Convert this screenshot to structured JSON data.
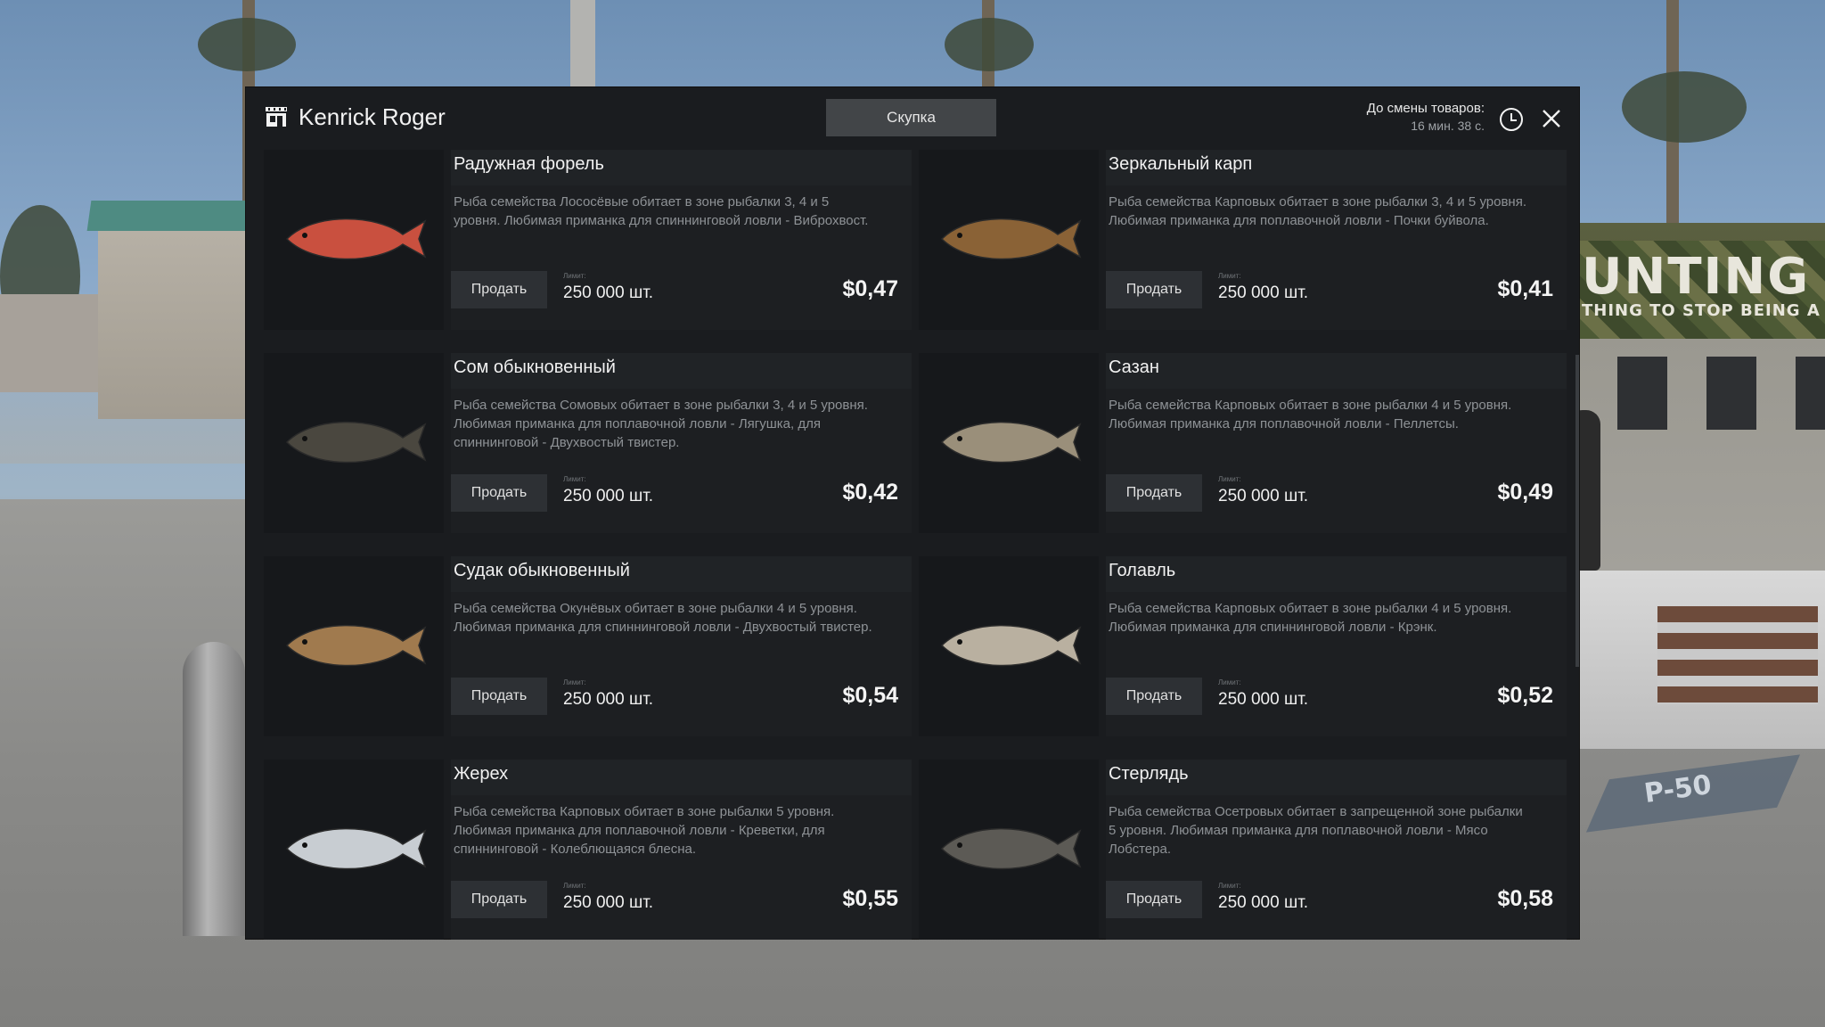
{
  "window": {
    "title": "Kenrick Roger",
    "tab_label": "Скупка",
    "timer_label": "До смены товаров:",
    "timer_value": "16 мин. 38 с."
  },
  "background": {
    "sign_text": "UNTING S",
    "sign_sub": "THING TO STOP BEING A",
    "mat_text": "P-50"
  },
  "common": {
    "sell_label": "Продать",
    "limit_label": "Лимит:"
  },
  "items": [
    {
      "name": "Радужная форель",
      "desc": "Рыба семейства Лососёвые обитает в зоне рыбалки 3, 4 и 5 уровня. Любимая приманка для спиннинговой ловли - Виброхвост.",
      "limit": "250 000 шт.",
      "price": "$0,47",
      "icon": "rainbow-trout-icon",
      "color": "#c9503f"
    },
    {
      "name": "Зеркальный карп",
      "desc": "Рыба семейства Карповых обитает в зоне рыбалки 3, 4 и 5 уровня. Любимая приманка для поплавочной ловли - Почки буйвола.",
      "limit": "250 000 шт.",
      "price": "$0,41",
      "icon": "mirror-carp-icon",
      "color": "#8a6236"
    },
    {
      "name": "Сом обыкновенный",
      "desc": "Рыба семейства Сомовых обитает в зоне рыбалки 3, 4 и 5 уровня. Любимая приманка для поплавочной ловли - Лягушка, для спиннинговой - Двухвостый твистер.",
      "limit": "250 000 шт.",
      "price": "$0,42",
      "icon": "catfish-icon",
      "color": "#4a473f"
    },
    {
      "name": "Сазан",
      "desc": "Рыба семейства Карповых обитает в зоне рыбалки 4 и 5 уровня. Любимая приманка для поплавочной ловли - Пеллетсы.",
      "limit": "250 000 шт.",
      "price": "$0,49",
      "icon": "wild-carp-icon",
      "color": "#9a8f7a"
    },
    {
      "name": "Судак обыкновенный",
      "desc": "Рыба семейства Окунёвых обитает в зоне рыбалки 4 и 5 уровня. Любимая приманка для спиннинговой ловли - Двухвостый твистер.",
      "limit": "250 000 шт.",
      "price": "$0,54",
      "icon": "zander-icon",
      "color": "#a07a4e"
    },
    {
      "name": "Голавль",
      "desc": "Рыба семейства Карповых обитает в зоне рыбалки 4 и 5 уровня. Любимая приманка для спиннинговой ловли - Крэнк.",
      "limit": "250 000 шт.",
      "price": "$0,52",
      "icon": "chub-icon",
      "color": "#b9b0a0"
    },
    {
      "name": "Жерех",
      "desc": "Рыба семейства Карповых обитает в зоне рыбалки 5 уровня. Любимая приманка для поплавочной ловли - Креветки, для спиннинговой - Колеблющаяся блесна.",
      "limit": "250 000 шт.",
      "price": "$0,55",
      "icon": "asp-icon",
      "color": "#c8cdd2"
    },
    {
      "name": "Стерлядь",
      "desc": "Рыба семейства Осетровых обитает в запрещенной зоне рыбалки 5 уровня. Любимая приманка для поплавочной ловли - Мясо Лобстера.",
      "limit": "250 000 шт.",
      "price": "$0,58",
      "icon": "sterlet-icon",
      "color": "#5c5a55"
    }
  ]
}
